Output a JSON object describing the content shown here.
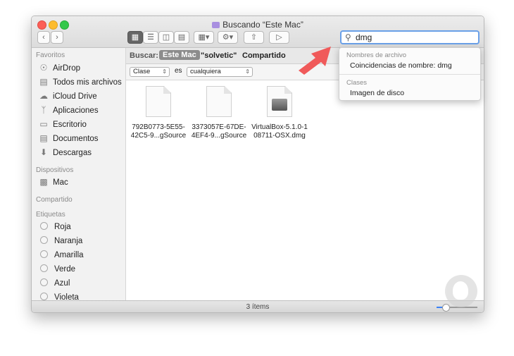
{
  "window": {
    "title": "Buscando “Este Mac”"
  },
  "toolbar": {
    "back_label": "‹",
    "forward_label": "›",
    "search_value": "dmg"
  },
  "sidebar": {
    "sections": {
      "favorites": "Favoritos",
      "devices": "Dispositivos",
      "shared": "Compartido",
      "tags": "Etiquetas"
    },
    "favorites": [
      {
        "label": "AirDrop",
        "icon": "airdrop-icon"
      },
      {
        "label": "Todos mis archivos",
        "icon": "all-files-icon"
      },
      {
        "label": "iCloud Drive",
        "icon": "cloud-icon"
      },
      {
        "label": "Aplicaciones",
        "icon": "applications-icon"
      },
      {
        "label": "Escritorio",
        "icon": "desktop-icon"
      },
      {
        "label": "Documentos",
        "icon": "documents-icon"
      },
      {
        "label": "Descargas",
        "icon": "downloads-icon"
      }
    ],
    "devices": [
      {
        "label": "Mac",
        "icon": "computer-icon"
      }
    ],
    "tags": [
      {
        "label": "Roja"
      },
      {
        "label": "Naranja"
      },
      {
        "label": "Amarilla"
      },
      {
        "label": "Verde"
      },
      {
        "label": "Azul"
      },
      {
        "label": "Violeta"
      }
    ]
  },
  "scope": {
    "label": "Buscar:",
    "selected": "Este Mac",
    "option2": "\"solvetic\"",
    "option3": "Compartido"
  },
  "filter": {
    "attribute": "Clase",
    "operator": "es",
    "value": "cualquiera"
  },
  "files": [
    {
      "line1": "792B0773-5E55-",
      "line2": "42C5-9...gSource",
      "kind": "document"
    },
    {
      "line1": "3373057E-67DE-",
      "line2": "4EF4-9...gSource",
      "kind": "document"
    },
    {
      "line1": "VirtualBox-5.1.0-1",
      "line2": "08711-OSX.dmg",
      "kind": "disk-image"
    }
  ],
  "status": {
    "count": "3 ítems",
    "zoom_fraction": 0.22
  },
  "suggestions": {
    "group1_title": "Nombres de archivo",
    "group1_item": "Coincidencias de nombre: dmg",
    "group2_title": "Clases",
    "group2_item": "Imagen de disco"
  },
  "colors": {
    "accent": "#6aa0e8",
    "arrow": "#f05a5a"
  }
}
